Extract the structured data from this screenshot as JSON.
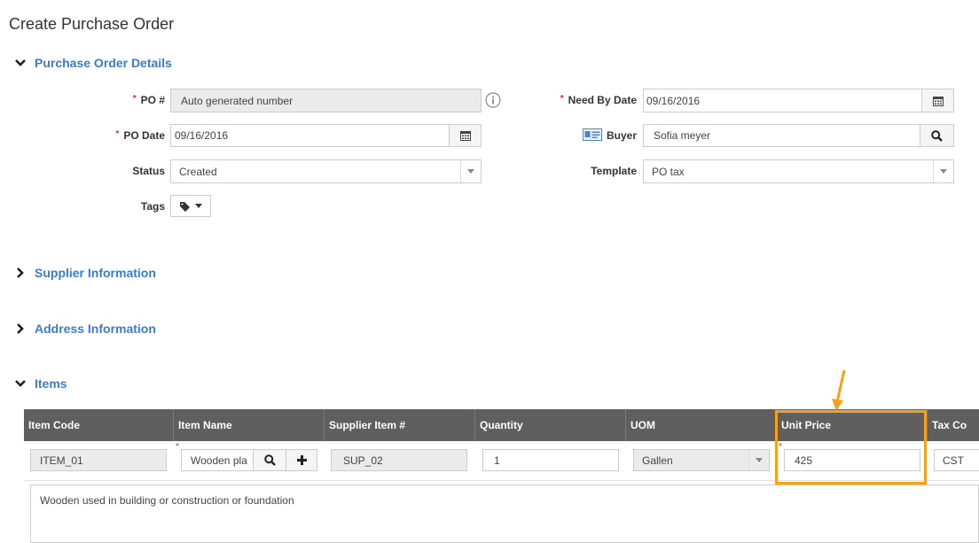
{
  "page": {
    "title": "Create Purchase Order"
  },
  "sections": {
    "po_details": "Purchase Order Details",
    "supplier": "Supplier Information",
    "address": "Address Information",
    "items": "Items"
  },
  "po_details": {
    "po_label": "PO #",
    "po_value": "Auto generated number",
    "po_date_label": "PO Date",
    "po_date_value": "09/16/2016",
    "status_label": "Status",
    "status_value": "Created",
    "tags_label": "Tags",
    "need_by_label": "Need By Date",
    "need_by_value": "09/16/2016",
    "buyer_label": "Buyer",
    "buyer_value": "Sofia meyer",
    "template_label": "Template",
    "template_value": "PO tax"
  },
  "items_table": {
    "columns": [
      "Item Code",
      "Item Name",
      "Supplier Item #",
      "Quantity",
      "UOM",
      "Unit Price",
      "Tax Co"
    ],
    "row": {
      "item_code": "ITEM_01",
      "item_name": "Wooden pla",
      "supplier_item": "SUP_02",
      "quantity": "1",
      "uom": "Gallen",
      "unit_price": "425",
      "tax_code": "CST"
    },
    "description": "Wooden used in building or construction or foundation"
  },
  "colors": {
    "accent": "#3a7bd5",
    "header_bg": "#5f5f5f",
    "highlight": "#f7a11a",
    "required": "#d9342b"
  }
}
